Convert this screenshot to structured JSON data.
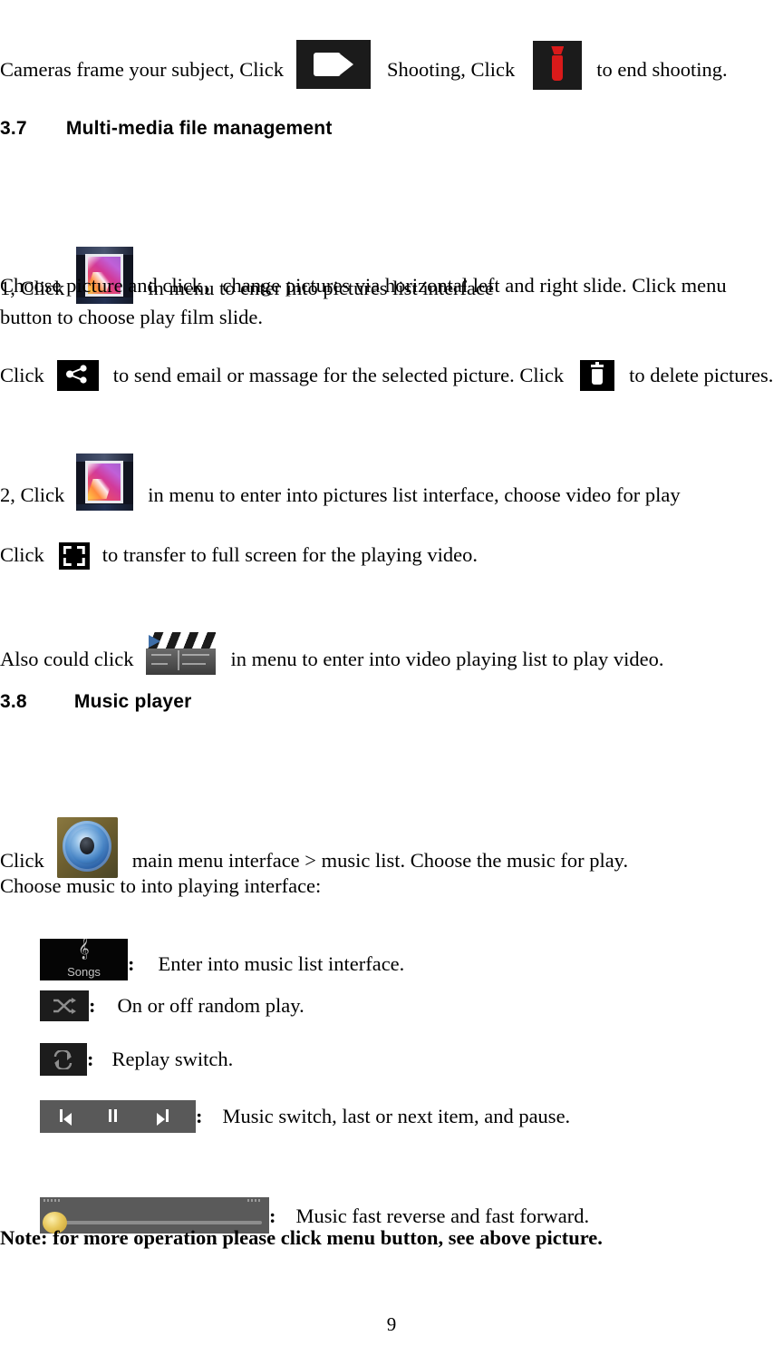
{
  "document": {
    "page_number": "9",
    "paragraph_1": {
      "text_before": "Cameras frame your subject, Click",
      "text_middle": "Shooting, Click",
      "text_after": "to end shooting.",
      "icon_1": "video-camera-icon",
      "icon_2": "stop-recording-icon"
    },
    "section_3_7": {
      "number": "3.7",
      "title": "Multi-media file management",
      "item_1": {
        "text_before": "1, Click",
        "icon": "gallery-icon",
        "text_after": "in menu to enter into pictures list interface"
      },
      "paragraph_choose": "Choose picture and click，change pictures via horizontal left and right slide. Click menu button to choose play film slide.",
      "share_line": {
        "text_before": "Click",
        "icon_1": "share-icon",
        "text_middle": "to send email or massage for the selected picture. Click",
        "icon_2": "delete-icon",
        "text_after": "to delete pictures."
      },
      "item_2": {
        "text_before": "2, Click",
        "icon": "gallery-icon",
        "text_after": "in menu to enter into pictures list interface, choose video for play"
      },
      "fullscreen_line": {
        "text_before": "Click",
        "icon": "fullscreen-icon",
        "text_after": "to transfer to full screen for the playing video."
      },
      "video_list_line": {
        "text_before": "Also could click",
        "icon": "clapperboard-icon",
        "text_after": "in menu to enter into video playing list to play video."
      }
    },
    "section_3_8": {
      "number": "3.8",
      "title": "Music player",
      "intro_line": {
        "text_before": "Click",
        "icon": "music-speaker-icon",
        "text_after": "main menu interface > music list. Choose the music for play."
      },
      "choose_line": "Choose music to into playing interface:",
      "controls": [
        {
          "icon": "songs-button-icon",
          "icon_label": "Songs",
          "separator": ":",
          "description": "Enter into music list interface."
        },
        {
          "icon": "shuffle-icon",
          "separator": ":",
          "description": "On or off random play."
        },
        {
          "icon": "repeat-icon",
          "separator": ":",
          "description": "Replay switch."
        },
        {
          "icon": "transport-controls-icon",
          "separator": ":",
          "description": "Music switch, last or next item, and pause."
        },
        {
          "icon": "seek-bar-icon",
          "separator": ":",
          "description": "Music fast reverse and fast forward."
        }
      ],
      "note": "Note: for more operation please click menu button, see above picture."
    },
    "colors": {
      "text": "#000000",
      "record_red": "#d91a1a",
      "icon_black": "#000000",
      "transport_gray": "#595959",
      "seek_thumb_gold": "#e8c85c"
    }
  }
}
